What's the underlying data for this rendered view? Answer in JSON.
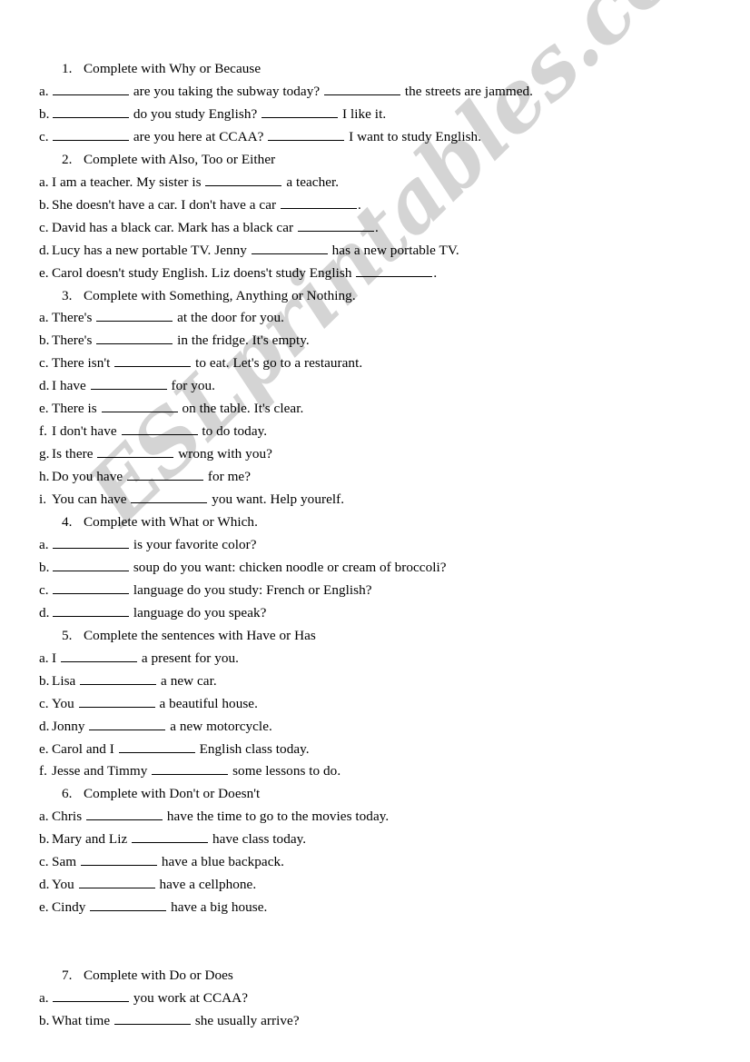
{
  "document": {
    "type": "worksheet",
    "page_background": "#ffffff",
    "text_color": "#000000"
  },
  "watermark": {
    "text": "ESLprintables.com",
    "color": "#d4d4d4",
    "rotation_deg": -44.5
  },
  "blank_placeholder": "____________",
  "exercises": [
    {
      "number": "1.",
      "instruction": "Complete with Why or Because",
      "items": [
        {
          "letter": "a.",
          "parts": [
            "",
            " are you taking the subway today? ",
            " the streets are jammed."
          ]
        },
        {
          "letter": "b.",
          "parts": [
            "",
            " do you study English? ",
            " I like it."
          ]
        },
        {
          "letter": "c.",
          "parts": [
            "",
            " are you here at CCAA? ",
            " I want to study English."
          ]
        }
      ]
    },
    {
      "number": "2.",
      "instruction": "Complete with Also, Too or Either",
      "items": [
        {
          "letter": "a.",
          "parts": [
            "I am a teacher. My sister is ",
            " a teacher."
          ]
        },
        {
          "letter": "b.",
          "parts": [
            "She doesn't have a car. I don't have a car ",
            "."
          ]
        },
        {
          "letter": "c.",
          "parts": [
            "David has a black car. Mark has a black car ",
            "."
          ]
        },
        {
          "letter": "d.",
          "parts": [
            "Lucy has a new portable TV. Jenny ",
            " has a new portable TV."
          ]
        },
        {
          "letter": "e.",
          "parts": [
            "Carol doesn't study English. Liz doens't study English ",
            "."
          ]
        }
      ]
    },
    {
      "number": "3.",
      "instruction": "Complete with Something, Anything or Nothing.",
      "items": [
        {
          "letter": "a.",
          "parts": [
            "There's ",
            " at the door for you."
          ]
        },
        {
          "letter": "b.",
          "parts": [
            "There's ",
            " in the fridge. It's empty."
          ]
        },
        {
          "letter": "c.",
          "parts": [
            "There isn't ",
            " to eat. Let's go to a restaurant."
          ]
        },
        {
          "letter": "d.",
          "parts": [
            "I have ",
            " for you."
          ]
        },
        {
          "letter": "e.",
          "parts": [
            "There is ",
            " on the table. It's clear."
          ]
        },
        {
          "letter": "f.",
          "parts": [
            "I don't have ",
            " to do today."
          ]
        },
        {
          "letter": "g.",
          "parts": [
            "Is there ",
            " wrong with you?"
          ]
        },
        {
          "letter": "h.",
          "parts": [
            "Do you have ",
            " for me?"
          ]
        },
        {
          "letter": "i.",
          "parts": [
            "You can have ",
            " you want. Help yourelf."
          ]
        }
      ]
    },
    {
      "number": "4.",
      "instruction": "Complete with What or Which.",
      "items": [
        {
          "letter": "a.",
          "parts": [
            "",
            " is your favorite color?"
          ]
        },
        {
          "letter": "b.",
          "parts": [
            "",
            " soup do you want: chicken noodle or cream of broccoli?"
          ]
        },
        {
          "letter": "c.",
          "parts": [
            "",
            " language do you study: French or English?"
          ]
        },
        {
          "letter": "d.",
          "parts": [
            "",
            " language do you speak?"
          ]
        }
      ]
    },
    {
      "number": "5.",
      "instruction": "Complete the sentences with Have or Has",
      "items": [
        {
          "letter": "a.",
          "parts": [
            "I ",
            " a present for you."
          ]
        },
        {
          "letter": "b.",
          "parts": [
            "Lisa ",
            " a new car."
          ]
        },
        {
          "letter": "c.",
          "parts": [
            "You ",
            " a beautiful house."
          ]
        },
        {
          "letter": "d.",
          "parts": [
            "Jonny ",
            " a new motorcycle."
          ]
        },
        {
          "letter": "e.",
          "parts": [
            "Carol and I ",
            " English class today."
          ]
        },
        {
          "letter": "f.",
          "parts": [
            "Jesse and Timmy ",
            " some lessons to do."
          ]
        }
      ]
    },
    {
      "number": "6.",
      "instruction": "Complete with Don't or Doesn't",
      "items": [
        {
          "letter": "a.",
          "parts": [
            "Chris ",
            " have the time to go to the movies today."
          ]
        },
        {
          "letter": "b.",
          "parts": [
            "Mary and Liz ",
            " have class today."
          ]
        },
        {
          "letter": "c.",
          "parts": [
            "Sam ",
            " have a blue backpack."
          ]
        },
        {
          "letter": "d.",
          "parts": [
            "You ",
            " have a cellphone."
          ]
        },
        {
          "letter": "e.",
          "parts": [
            "Cindy ",
            " have a big house."
          ]
        }
      ]
    },
    {
      "number": "7.",
      "instruction": "Complete with Do or Does",
      "gap_before": true,
      "items": [
        {
          "letter": "a.",
          "parts": [
            "",
            " you work at CCAA?"
          ]
        },
        {
          "letter": "b.",
          "parts": [
            "What time ",
            " she usually arrive?"
          ]
        }
      ]
    }
  ]
}
